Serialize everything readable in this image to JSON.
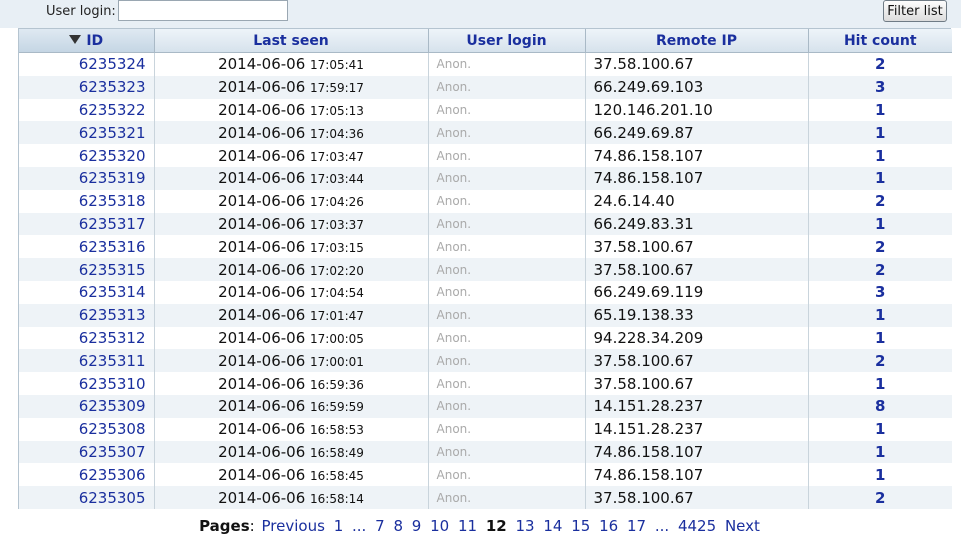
{
  "filter": {
    "login_label": "User login:",
    "login_value": "",
    "button_label": "Filter list"
  },
  "table": {
    "headers": {
      "id": "ID",
      "last_seen": "Last seen",
      "user_login": "User login",
      "remote_ip": "Remote IP",
      "hit_count": "Hit count"
    },
    "rows": [
      {
        "id": "6235324",
        "date": "2014-06-06",
        "time": "17:05:41",
        "login": "Anon.",
        "ip": "37.58.100.67",
        "hits": "2"
      },
      {
        "id": "6235323",
        "date": "2014-06-06",
        "time": "17:59:17",
        "login": "Anon.",
        "ip": "66.249.69.103",
        "hits": "3"
      },
      {
        "id": "6235322",
        "date": "2014-06-06",
        "time": "17:05:13",
        "login": "Anon.",
        "ip": "120.146.201.10",
        "hits": "1"
      },
      {
        "id": "6235321",
        "date": "2014-06-06",
        "time": "17:04:36",
        "login": "Anon.",
        "ip": "66.249.69.87",
        "hits": "1"
      },
      {
        "id": "6235320",
        "date": "2014-06-06",
        "time": "17:03:47",
        "login": "Anon.",
        "ip": "74.86.158.107",
        "hits": "1"
      },
      {
        "id": "6235319",
        "date": "2014-06-06",
        "time": "17:03:44",
        "login": "Anon.",
        "ip": "74.86.158.107",
        "hits": "1"
      },
      {
        "id": "6235318",
        "date": "2014-06-06",
        "time": "17:04:26",
        "login": "Anon.",
        "ip": "24.6.14.40",
        "hits": "2"
      },
      {
        "id": "6235317",
        "date": "2014-06-06",
        "time": "17:03:37",
        "login": "Anon.",
        "ip": "66.249.83.31",
        "hits": "1"
      },
      {
        "id": "6235316",
        "date": "2014-06-06",
        "time": "17:03:15",
        "login": "Anon.",
        "ip": "37.58.100.67",
        "hits": "2"
      },
      {
        "id": "6235315",
        "date": "2014-06-06",
        "time": "17:02:20",
        "login": "Anon.",
        "ip": "37.58.100.67",
        "hits": "2"
      },
      {
        "id": "6235314",
        "date": "2014-06-06",
        "time": "17:04:54",
        "login": "Anon.",
        "ip": "66.249.69.119",
        "hits": "3"
      },
      {
        "id": "6235313",
        "date": "2014-06-06",
        "time": "17:01:47",
        "login": "Anon.",
        "ip": "65.19.138.33",
        "hits": "1"
      },
      {
        "id": "6235312",
        "date": "2014-06-06",
        "time": "17:00:05",
        "login": "Anon.",
        "ip": "94.228.34.209",
        "hits": "1"
      },
      {
        "id": "6235311",
        "date": "2014-06-06",
        "time": "17:00:01",
        "login": "Anon.",
        "ip": "37.58.100.67",
        "hits": "2"
      },
      {
        "id": "6235310",
        "date": "2014-06-06",
        "time": "16:59:36",
        "login": "Anon.",
        "ip": "37.58.100.67",
        "hits": "1"
      },
      {
        "id": "6235309",
        "date": "2014-06-06",
        "time": "16:59:59",
        "login": "Anon.",
        "ip": "14.151.28.237",
        "hits": "8"
      },
      {
        "id": "6235308",
        "date": "2014-06-06",
        "time": "16:58:53",
        "login": "Anon.",
        "ip": "14.151.28.237",
        "hits": "1"
      },
      {
        "id": "6235307",
        "date": "2014-06-06",
        "time": "16:58:49",
        "login": "Anon.",
        "ip": "74.86.158.107",
        "hits": "1"
      },
      {
        "id": "6235306",
        "date": "2014-06-06",
        "time": "16:58:45",
        "login": "Anon.",
        "ip": "74.86.158.107",
        "hits": "1"
      },
      {
        "id": "6235305",
        "date": "2014-06-06",
        "time": "16:58:14",
        "login": "Anon.",
        "ip": "37.58.100.67",
        "hits": "2"
      }
    ]
  },
  "pager": {
    "label": "Pages",
    "colon": ":",
    "previous": "Previous",
    "next": "Next",
    "ellipsis": "...",
    "first": "1",
    "before": [
      "7",
      "8",
      "9",
      "10",
      "11"
    ],
    "current": "12",
    "after": [
      "13",
      "14",
      "15",
      "16",
      "17"
    ],
    "last": "4425"
  },
  "icons": {
    "sort": "sort-descending-icon"
  }
}
